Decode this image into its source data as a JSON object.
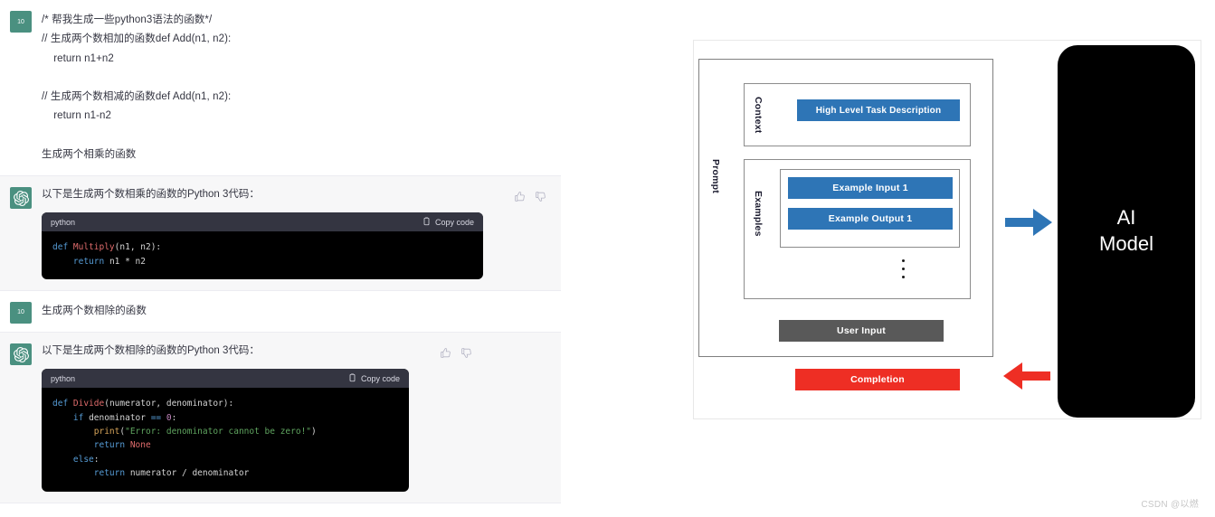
{
  "chat": {
    "messages": [
      {
        "role": "user",
        "avatar_label": "10",
        "text": "/* 帮我生成一些python3语法的函数*/\n// 生成两个数相加的函数def Add(n1, n2):\n    return n1+n2\n\n// 生成两个数相减的函数def Add(n1, n2):\n    return n1-n2\n\n生成两个相乘的函数"
      },
      {
        "role": "assistant",
        "reply": "以下是生成两个数相乘的函数的Python 3代码：",
        "code_lang": "python",
        "copy_label": "Copy code",
        "code_lines": [
          {
            "tokens": [
              {
                "t": "def ",
                "c": "kw"
              },
              {
                "t": "Multiply",
                "c": "fn"
              },
              {
                "t": "(n1, n2):",
                "c": "pl"
              }
            ]
          },
          {
            "tokens": [
              {
                "t": "    ",
                "c": "pl"
              },
              {
                "t": "return",
                "c": "kw"
              },
              {
                "t": " n1 * n2",
                "c": "pl"
              }
            ]
          }
        ]
      },
      {
        "role": "user",
        "avatar_label": "10",
        "text": "生成两个数相除的函数"
      },
      {
        "role": "assistant",
        "reply": "以下是生成两个数相除的函数的Python 3代码：",
        "code_lang": "python",
        "copy_label": "Copy code",
        "code_lines": [
          {
            "tokens": [
              {
                "t": "def ",
                "c": "kw"
              },
              {
                "t": "Divide",
                "c": "fn"
              },
              {
                "t": "(numerator, denominator):",
                "c": "pl"
              }
            ]
          },
          {
            "tokens": [
              {
                "t": "    ",
                "c": "pl"
              },
              {
                "t": "if",
                "c": "kw"
              },
              {
                "t": " denominator ",
                "c": "pl"
              },
              {
                "t": "==",
                "c": "kw"
              },
              {
                "t": " ",
                "c": "pl"
              },
              {
                "t": "0",
                "c": "num"
              },
              {
                "t": ":",
                "c": "pl"
              }
            ]
          },
          {
            "tokens": [
              {
                "t": "        ",
                "c": "pl"
              },
              {
                "t": "print",
                "c": "bi"
              },
              {
                "t": "(",
                "c": "pl"
              },
              {
                "t": "\"Error: denominator cannot be zero!\"",
                "c": "str"
              },
              {
                "t": ")",
                "c": "pl"
              }
            ]
          },
          {
            "tokens": [
              {
                "t": "        ",
                "c": "pl"
              },
              {
                "t": "return",
                "c": "kw"
              },
              {
                "t": " ",
                "c": "pl"
              },
              {
                "t": "None",
                "c": "cn"
              }
            ]
          },
          {
            "tokens": [
              {
                "t": "    ",
                "c": "pl"
              },
              {
                "t": "else",
                "c": "kw"
              },
              {
                "t": ":",
                "c": "pl"
              }
            ]
          },
          {
            "tokens": [
              {
                "t": "        ",
                "c": "pl"
              },
              {
                "t": "return",
                "c": "kw"
              },
              {
                "t": " numerator / denominator",
                "c": "pl"
              }
            ]
          }
        ]
      }
    ]
  },
  "diagram": {
    "prompt_label": "Prompt",
    "context_label": "Context",
    "examples_label": "Examples",
    "high_level_task": "High Level Task Description",
    "example_input_1": "Example Input 1",
    "example_output_1": "Example Output 1",
    "user_input": "User Input",
    "completion": "Completion",
    "ai_model_line1": "AI",
    "ai_model_line2": "Model",
    "arrow_in_color": "#2e75b6",
    "arrow_out_color": "#ee2e24",
    "blue": "#2e75b6",
    "gray": "#595959",
    "red": "#ee2e24"
  },
  "watermark": "CSDN @以燃"
}
